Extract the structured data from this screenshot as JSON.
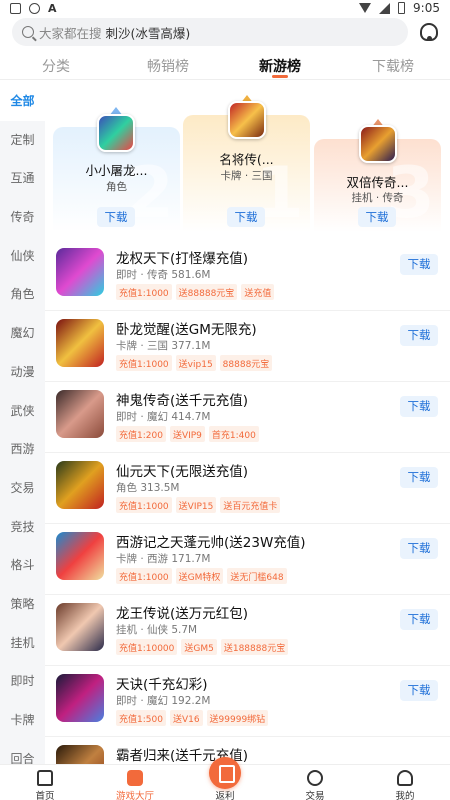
{
  "status_bar": {
    "time": "9:05"
  },
  "search": {
    "hint": "大家都在搜",
    "hot_keyword": "刺沙(冰雪高爆)"
  },
  "tabs": [
    "分类",
    "畅销榜",
    "新游榜",
    "下载榜"
  ],
  "active_tab": "新游榜",
  "left_nav": [
    "全部",
    "定制",
    "互通",
    "传奇",
    "仙侠",
    "角色",
    "魔幻",
    "动漫",
    "武侠",
    "西游",
    "交易",
    "竞技",
    "格斗",
    "策略",
    "挂机",
    "即时",
    "卡牌",
    "回合"
  ],
  "active_nav": "全部",
  "podium": [
    {
      "rank": "2",
      "name": "小小屠龙...",
      "tag": "角色",
      "button": "下载"
    },
    {
      "rank": "1",
      "name": "名将传(...",
      "tag": "卡牌 · 三国",
      "button": "下载"
    },
    {
      "rank": "3",
      "name": "双倍传奇...",
      "tag": "挂机 · 传奇",
      "button": "下载"
    }
  ],
  "games": [
    {
      "title": "龙权天下(打怪爆充值)",
      "meta": "即时 · 传奇",
      "size": "581.6M",
      "tags": [
        "充值1:1000",
        "送88888元宝",
        "送充值"
      ],
      "button": "下载"
    },
    {
      "title": "卧龙觉醒(送GM无限充)",
      "meta": "卡牌 · 三国",
      "size": "377.1M",
      "tags": [
        "充值1:1000",
        "送vip15",
        "88888元宝"
      ],
      "button": "下载"
    },
    {
      "title": "神鬼传奇(送千元充值)",
      "meta": "即时 · 魔幻",
      "size": "414.7M",
      "tags": [
        "充值1:200",
        "送VIP9",
        "首充1:400"
      ],
      "button": "下载"
    },
    {
      "title": "仙元天下(无限送充值)",
      "meta": "角色",
      "size": "313.5M",
      "tags": [
        "充值1:1000",
        "送VIP15",
        "送百元充值卡"
      ],
      "button": "下载"
    },
    {
      "title": "西游记之天蓬元帅(送23W充值)",
      "meta": "卡牌 · 西游",
      "size": "171.7M",
      "tags": [
        "充值1:1000",
        "送GM特权",
        "送无门槛648"
      ],
      "button": "下载"
    },
    {
      "title": "龙王传说(送万元红包)",
      "meta": "挂机 · 仙侠",
      "size": "5.7M",
      "tags": [
        "充值1:10000",
        "送GM5",
        "送188888元宝"
      ],
      "button": "下载"
    },
    {
      "title": "天诀(千充幻彩)",
      "meta": "即时 · 魔幻",
      "size": "192.2M",
      "tags": [
        "充值1:500",
        "送V16",
        "送99999绑钻"
      ],
      "button": "下载"
    },
    {
      "title": "霸者归来(送千元充值)",
      "meta": "",
      "size": "",
      "tags": [],
      "button": ""
    }
  ],
  "bottom_nav": [
    "首页",
    "游戏大厅",
    "返利",
    "交易",
    "我的"
  ],
  "active_bottom": "游戏大厅",
  "colors": {
    "accent": "#f26a3b",
    "blue": "#1e88e5"
  }
}
